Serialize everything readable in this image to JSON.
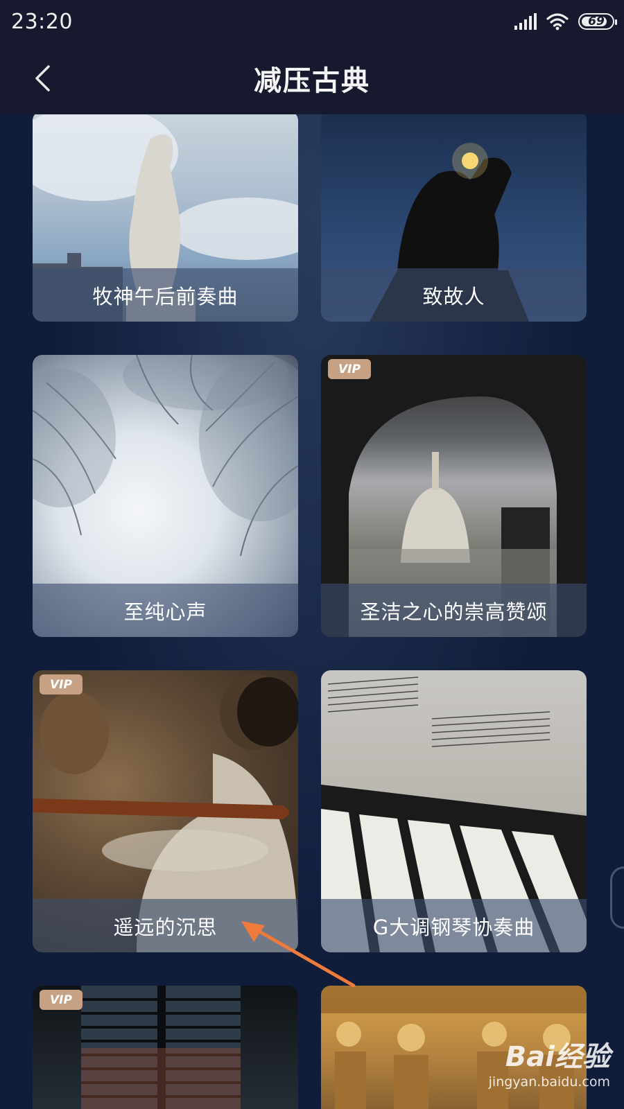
{
  "status_bar": {
    "time": "23:20",
    "battery": "69"
  },
  "header": {
    "title": "减压古典"
  },
  "cards": [
    {
      "title": "牧神午后前奏曲",
      "vip": false
    },
    {
      "title": "致故人",
      "vip": false
    },
    {
      "title": "至纯心声",
      "vip": false
    },
    {
      "title": "圣洁之心的崇高赞颂",
      "vip": true,
      "vip_label": "VIP"
    },
    {
      "title": "遥远的沉思",
      "vip": true,
      "vip_label": "VIP"
    },
    {
      "title": "G大调钢琴协奏曲",
      "vip": false
    },
    {
      "title": "",
      "vip": true,
      "vip_label": "VIP"
    },
    {
      "title": "",
      "vip": false
    }
  ],
  "watermark": {
    "main": "Bai经验",
    "sub": "jingyan.baidu.com"
  },
  "colors": {
    "background": "#0f1c3a",
    "header": "#171a2e",
    "vip_badge": "#c7a184",
    "annotation_arrow": "#ee7a3b"
  }
}
